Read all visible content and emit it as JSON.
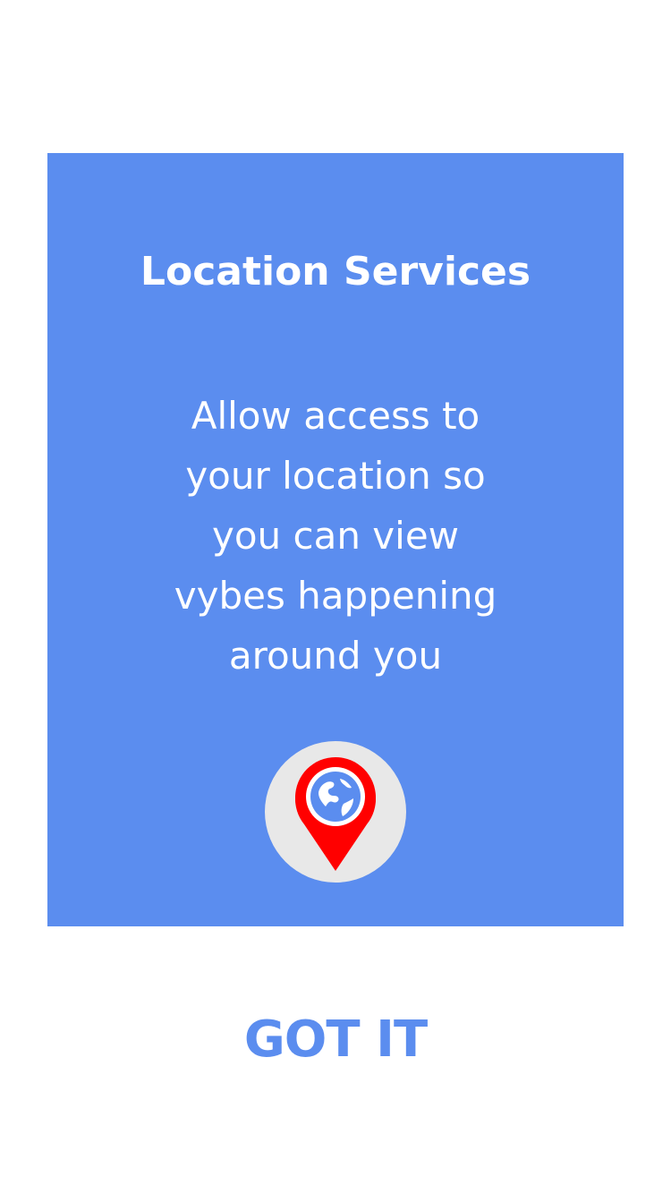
{
  "dialog": {
    "title": "Location Services",
    "message_lines": [
      "Allow access to",
      "your location so",
      "you can view",
      "vybes happening",
      "around you"
    ],
    "icon": "location-pin-globe-icon",
    "button_label": "GOT IT"
  },
  "colors": {
    "card_background": "#5b8def",
    "button_text": "#5b8def",
    "icon_circle": "#e8e8e8",
    "pin": "#ff0000"
  }
}
